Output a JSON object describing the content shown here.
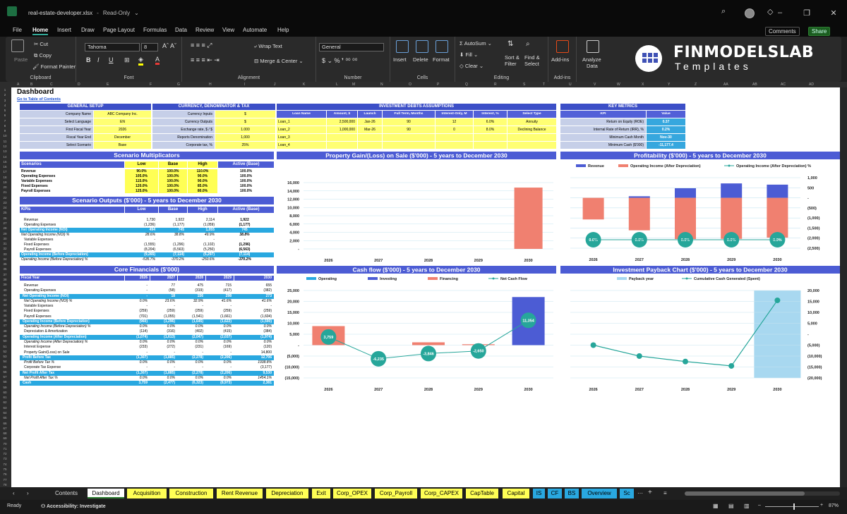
{
  "window": {
    "filename": "real-estate-developer.xlsx",
    "mode": "Read-Only"
  },
  "menu": [
    "File",
    "Home",
    "Insert",
    "Draw",
    "Page Layout",
    "Formulas",
    "Data",
    "Review",
    "View",
    "Automate",
    "Help"
  ],
  "menu_active": "Home",
  "comments_label": "Comments",
  "share_label": "Share",
  "ribbon": {
    "clipboard": {
      "paste": "Paste",
      "cut": "Cut",
      "copy": "Copy",
      "format_painter": "Format Painter",
      "label": "Clipboard"
    },
    "font": {
      "name": "Tahoma",
      "size": "8",
      "label": "Font",
      "bold": "B",
      "italic": "I",
      "underline": "U"
    },
    "alignment": {
      "wrap": "Wrap Text",
      "merge": "Merge & Center",
      "label": "Alignment"
    },
    "number": {
      "format": "General",
      "label": "Number"
    },
    "cells": {
      "insert": "Insert",
      "delete": "Delete",
      "format": "Format",
      "label": "Cells"
    },
    "editing": {
      "autosum": "AutoSum",
      "fill": "Fill",
      "clear": "Clear",
      "sort": "Sort &",
      "filter": "Filter",
      "find": "Find &",
      "select": "Select",
      "label": "Editing"
    },
    "addins": {
      "addins": "Add-ins",
      "label": "Add-ins"
    },
    "analyze": {
      "l1": "Analyze",
      "l2": "Data"
    }
  },
  "logo": {
    "line1": "FINMODELSLAB",
    "line2": "Templates"
  },
  "columns": [
    "A",
    "B",
    "C",
    "D",
    "E",
    "F",
    "G",
    "H",
    "I",
    "J",
    "K",
    "L",
    "M",
    "N",
    "O",
    "P",
    "Q",
    "R",
    "S",
    "T",
    "U",
    "V",
    "W",
    "X",
    "Y",
    "Z",
    "AA",
    "AB",
    "AC",
    "AD"
  ],
  "dashboard": {
    "title": "Dashboard",
    "toc_link": "Go to Table of Contents",
    "general_setup": {
      "header": "GENERAL SETUP",
      "rows": [
        [
          "Company Name",
          "ABC Company Inc."
        ],
        [
          "Select Language",
          "EN"
        ],
        [
          "First Fiscal Year",
          "2026"
        ],
        [
          "Fiscal Year End",
          "December"
        ],
        [
          "Select Scenario",
          "Base"
        ]
      ]
    },
    "currency": {
      "header": "CURRENCY, DENOMINATOR & TAX",
      "rows": [
        [
          "Currency Inputs",
          "$"
        ],
        [
          "Currency Outputs",
          "$"
        ],
        [
          "Exchange rate, $ / $",
          "1.000"
        ],
        [
          "Reports Denomination",
          "1,000"
        ],
        [
          "Corporate tax, %",
          "25%"
        ]
      ]
    },
    "debts": {
      "header": "INVESTMENT DEBTS ASSUMPTIONS",
      "cols": [
        "Loan Name",
        "Amount, $",
        "Launch",
        "Full Term, Months",
        "Interest-Only, M",
        "Interest, %",
        "Select Type"
      ],
      "rows": [
        [
          "Loan_1",
          "2,500,000",
          "Jan-26",
          "90",
          "12",
          "6.0%",
          "Annuity"
        ],
        [
          "Loan_2",
          "1,000,000",
          "Mar-26",
          "90",
          "0",
          "8.0%",
          "Declining Balance"
        ],
        [
          "Loan_3",
          "",
          "",
          "",
          "",
          "",
          ""
        ],
        [
          "Loan_4",
          "",
          "",
          "",
          "",
          "",
          ""
        ]
      ]
    },
    "key_metrics": {
      "header": "KEY METRICS",
      "cols": [
        "KPI",
        "Value"
      ],
      "rows": [
        [
          "Return on Equity (ROE)",
          "0.37"
        ],
        [
          "Internal Rate of Return (IRR), %",
          "0.2%"
        ],
        [
          "Minimum Cash Month",
          "Nov-30"
        ],
        [
          "Minimum Cash ($'000)",
          "-11,177.4"
        ]
      ]
    },
    "multipliers": {
      "title": "Scenario Multiplicators",
      "cols": [
        "Scenarios",
        "Low",
        "Base",
        "High",
        "Active (Base)"
      ],
      "rows": [
        [
          "Revenue",
          "90.0%",
          "100.0%",
          "110.0%",
          "100.0%"
        ],
        [
          "Operating Expenses",
          "105.0%",
          "100.0%",
          "90.0%",
          "100.0%"
        ],
        [
          "Variable Expenses",
          "115.0%",
          "100.0%",
          "90.0%",
          "100.0%"
        ],
        [
          "Fixed Expenses",
          "120.0%",
          "100.0%",
          "85.0%",
          "100.0%"
        ],
        [
          "Payroll Expenses",
          "125.0%",
          "100.0%",
          "80.0%",
          "100.0%"
        ]
      ]
    },
    "outputs": {
      "title": "Scenario Outputs ($'000) - 5 years to December 2030",
      "cols": [
        "KPIs",
        "Low",
        "Base",
        "High",
        "Active (Base)"
      ],
      "rows": [
        [
          "Revenue",
          "1,730",
          "1,922",
          "2,114",
          "1,922"
        ],
        [
          "Operating Expenses",
          "(1,236)",
          "(1,177)",
          "(1,059)",
          "(1,177)"
        ],
        [
          "Net Operating Income (NOI)",
          "494",
          "745",
          "1,055",
          "745"
        ],
        [
          "Net Operating Income (NOI) %",
          "28.6%",
          "38.8%",
          "49.9%",
          "38.8%"
        ],
        [
          "Variable Expenses",
          "-",
          "-",
          "-",
          "-"
        ],
        [
          "Fixed Expenses",
          "(1,555)",
          "(1,296)",
          "(1,102)",
          "(1,296)"
        ],
        [
          "Payroll Expenses",
          "(8,204)",
          "(6,563)",
          "(5,250)",
          "(6,563)"
        ],
        [
          "Operating Income (Before Depreciation)",
          "(9,265)",
          "(7,114)",
          "(5,297)",
          "(7,114)"
        ],
        [
          "Operating Income (Before Depreciation) %",
          "-535.7%",
          "-370.2%",
          "-250.6%",
          "-370.2%"
        ]
      ]
    },
    "core": {
      "title": "Core Financials ($'000)",
      "cols": [
        "Fiscal Year",
        "2026",
        "2027",
        "2028",
        "2029",
        "2030"
      ],
      "rows": [
        [
          "Revenue",
          "-",
          "77",
          "475",
          "715",
          "655"
        ],
        [
          "Operating Expenses",
          "-",
          "(58)",
          "(319)",
          "(417)",
          "(382)"
        ],
        [
          "Net Operating Income (NOI)",
          "-",
          "18",
          "156",
          "298",
          "273"
        ],
        [
          "Net Operating Income (NOI) %",
          "0.0%",
          "23.6%",
          "32.9%",
          "41.6%",
          "41.6%"
        ],
        [
          "Variable Expenses",
          "-",
          "-",
          "-",
          "-",
          "-"
        ],
        [
          "Fixed Expenses",
          "(259)",
          "(259)",
          "(259)",
          "(259)",
          "(259)"
        ],
        [
          "Payroll Expenses",
          "(701)",
          "(1,055)",
          "(1,541)",
          "(1,661)",
          "(1,604)"
        ],
        [
          "Operating Income (Before Depreciation)",
          "(960)",
          "(1,296)",
          "(1,645)",
          "(1,622)",
          "(1,590)"
        ],
        [
          "Operating Income (Before Depreciation) %",
          "0.0%",
          "0.0%",
          "0.0%",
          "0.0%",
          "0.0%"
        ],
        [
          "Depreciation & Amortization",
          "(114)",
          "(316)",
          "(402)",
          "(415)",
          "(384)"
        ],
        [
          "Operating Income (After Depreciation)",
          "(1,074)",
          "(1,613)",
          "(2,047)",
          "(2,037)",
          "(1,974)"
        ],
        [
          "Operating Income (After Depreciation) %",
          "0.0%",
          "0.0%",
          "0.0%",
          "0.0%",
          "0.0%"
        ],
        [
          "Interest Expense",
          "(233)",
          "(272)",
          "(231)",
          "(169)",
          "(120)"
        ],
        [
          "Property Gain/(Loss) on Sale",
          "-",
          "-",
          "-",
          "-",
          "14,800"
        ],
        [
          "Profit Before Tax",
          "(1,307)",
          "(1,885)",
          "(2,278)",
          "(2,206)",
          "12,706"
        ],
        [
          "Profit Before Tax %",
          "0.0%",
          "0.0%",
          "0.0%",
          "0.0%",
          "1938.8%"
        ],
        [
          "Corporate Tax Expense",
          "-",
          "-",
          "-",
          "-",
          "(3,177)"
        ],
        [
          "Net Profit After Tax",
          "(1,307)",
          "(1,885)",
          "(2,278)",
          "(2,206)",
          "9,530"
        ],
        [
          "Net Profit After Tax %",
          "0.0%",
          "0.0%",
          "0.0%",
          "0.0%",
          "1454.1%"
        ],
        [
          "Cash",
          "3,759",
          "(2,477)",
          "(6,323)",
          "(8,973)",
          "2,381"
        ]
      ]
    }
  },
  "chart_data": [
    {
      "type": "bar",
      "title": "Property Gain/(Loss) on Sale ($'000) - 5 years to December 2030",
      "categories": [
        "2026",
        "2027",
        "2028",
        "2029",
        "2030"
      ],
      "values": [
        0,
        0,
        0,
        0,
        14800
      ],
      "ylim": [
        0,
        16000
      ],
      "yticks": [
        "16,000",
        "14,000",
        "12,000",
        "10,000",
        "8,000",
        "6,000",
        "4,000",
        "2,000",
        "-"
      ],
      "color": "#f08070"
    },
    {
      "type": "bar",
      "title": "Profitability ($'000) - 5 years to December 2030",
      "categories": [
        "2026",
        "2027",
        "2028",
        "2029",
        "2030"
      ],
      "series": [
        {
          "name": "Revenue",
          "values": [
            0,
            77,
            475,
            715,
            655
          ],
          "color": "#4c5cd4"
        },
        {
          "name": "Operating Income (After Depreciation)",
          "values": [
            -1074,
            -1613,
            -2047,
            -2037,
            -1974
          ],
          "color": "#f08070"
        },
        {
          "name": "Operating Income (After Depreciation) %",
          "values": [
            0,
            0,
            0,
            0,
            0
          ],
          "labels": [
            "0.0%",
            "0.0%",
            "0.0%",
            "0.0%",
            "0.0%"
          ],
          "color": "#26a69a"
        }
      ],
      "yticks": [
        "1,000",
        "500",
        "-",
        "(500)",
        "(1,000)",
        "(1,500)",
        "(2,000)",
        "(2,500)"
      ],
      "ylim": [
        -2500,
        1000
      ]
    },
    {
      "type": "bar",
      "title": "Cash flow ($'000) - 5 years to December 2030",
      "categories": [
        "2026",
        "2027",
        "2028",
        "2029",
        "2030"
      ],
      "series": [
        {
          "name": "Operating",
          "values": [
            -960,
            -1296,
            -1645,
            -1622,
            -1590
          ],
          "color": "#29a8e0"
        },
        {
          "name": "Investing",
          "values": [
            -4000,
            -3500,
            -2500,
            -1500,
            22000
          ],
          "color": "#4c5cd4"
        },
        {
          "name": "Financing",
          "values": [
            8719,
            -1440,
            1300,
            400,
            -6500
          ],
          "color": "#f08070"
        },
        {
          "name": "Net Cash Flow",
          "values": [
            3759,
            -6235,
            -3846,
            -2650,
            11354
          ],
          "labels": [
            "3,759",
            "-6,235",
            "-3,846",
            "-2,650",
            "11,354"
          ],
          "color": "#26a69a"
        }
      ],
      "yticks": [
        "25,000",
        "20,000",
        "15,000",
        "10,000",
        "5,000",
        "-",
        "(5,000)",
        "(10,000)",
        "(15,000)"
      ],
      "ylim": [
        -15000,
        25000
      ]
    },
    {
      "type": "line",
      "title": "Investment Payback Chart ($'000) - 5 years to December 2030",
      "categories": [
        "2026",
        "2027",
        "2028",
        "2029",
        "2030"
      ],
      "series": [
        {
          "name": "Payback year",
          "values": [
            0,
            0,
            0,
            0,
            1
          ],
          "color": "#a8d8f0"
        },
        {
          "name": "Cumulative Cash Generated (Spent)",
          "values": [
            -5000,
            -10000,
            -12500,
            -14500,
            15500
          ],
          "color": "#26a69a"
        }
      ],
      "yticks": [
        "20,000",
        "15,000",
        "10,000",
        "5,000",
        "-",
        "(5,000)",
        "(10,000)",
        "(15,000)",
        "(20,000)"
      ],
      "ylim": [
        -20000,
        20000
      ]
    }
  ],
  "tabs": [
    [
      "Contents",
      "w"
    ],
    [
      "Dashboard",
      "act"
    ],
    [
      "Acquisition",
      "y"
    ],
    [
      "Construction",
      "y"
    ],
    [
      "Rent Revenue",
      "y"
    ],
    [
      "Depreciation",
      "y"
    ],
    [
      "Exit",
      "y"
    ],
    [
      "Corp_OPEX",
      "y"
    ],
    [
      "Corp_Payroll",
      "y"
    ],
    [
      "Corp_CAPEX",
      "y"
    ],
    [
      "CapTable",
      "y"
    ],
    [
      "Capital",
      "y"
    ],
    [
      "IS",
      "b"
    ],
    [
      "CF",
      "b"
    ],
    [
      "BS",
      "b"
    ],
    [
      "Overview",
      "b"
    ],
    [
      "Sc",
      "b"
    ]
  ],
  "status": {
    "ready": "Ready",
    "accessibility": "Accessibility: Investigate",
    "zoom": "87%"
  }
}
